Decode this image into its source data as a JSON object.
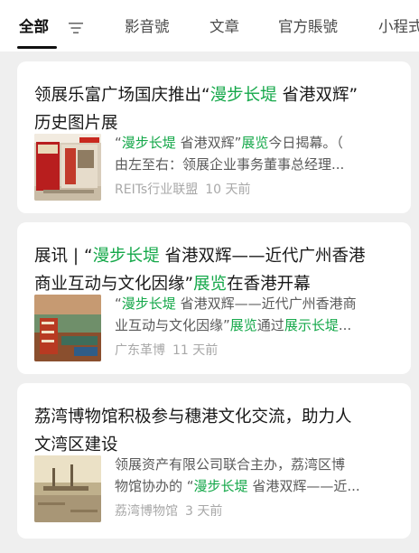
{
  "tabs": [
    {
      "label": "全部"
    },
    {
      "label": "影音號"
    },
    {
      "label": "文章"
    },
    {
      "label": "官方賬號"
    },
    {
      "label": "小程式"
    }
  ],
  "icons": {
    "filter": "filter-icon"
  },
  "colors": {
    "highlight": "#15a84a",
    "meta": "#a8a8a8",
    "background": "#efefef"
  },
  "results": [
    {
      "title": [
        "领展乐富广场国庆推出“",
        "漫步长堤",
        " 省港双辉”",
        "历史图片展"
      ],
      "snippet": [
        "“",
        "漫步长堤",
        " 省港双辉”",
        "展览",
        "今日揭幕。（",
        "由左至右：领展企业事务董事总经理..."
      ],
      "source": "REITs行业联盟",
      "time": "10 天前"
    },
    {
      "title": [
        "展讯 | “",
        "漫步长堤",
        " 省港双辉——近代广州香港",
        "商业互动与文化因缘”",
        "展览",
        "在香港开幕"
      ],
      "snippet": [
        "“",
        "漫步长堤",
        " 省港双辉——近代广州香港商",
        "业互动与文化因缘”",
        "展览",
        "通过",
        "展示长堤",
        "..."
      ],
      "source": "广东革博",
      "time": "11 天前"
    },
    {
      "title": [
        "荔湾博物馆积极参与穗港文化交流，助力人",
        "文湾区建设"
      ],
      "snippet": [
        "领展资产有限公司联合主办，荔湾区博",
        "物馆协办的 “",
        "漫步长堤",
        " 省港双辉——近..."
      ],
      "source": "荔湾博物馆",
      "time": "3 天前"
    }
  ]
}
